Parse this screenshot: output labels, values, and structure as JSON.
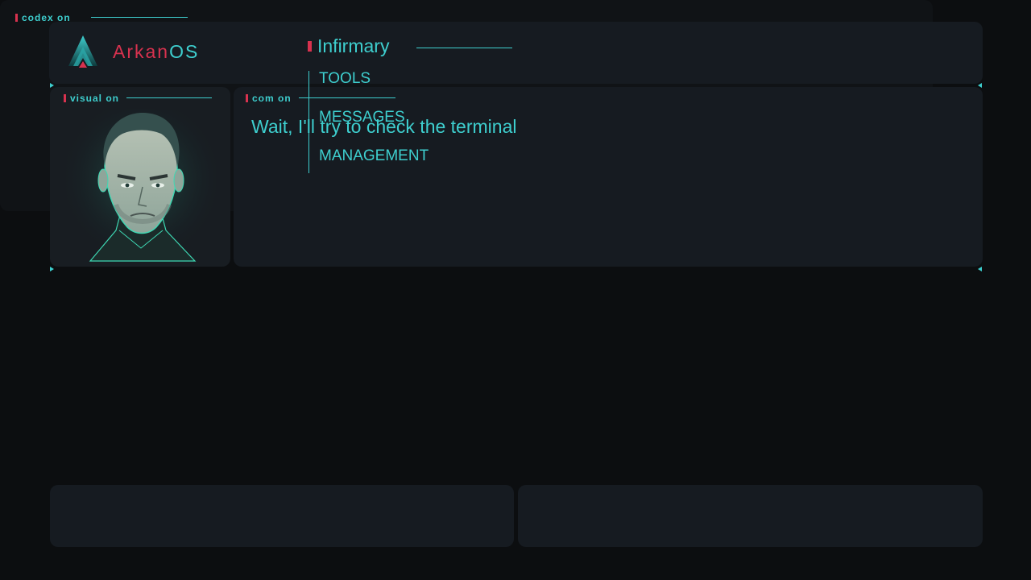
{
  "header": {
    "brand_part1": "Arkan",
    "brand_part2": "OS",
    "logo_icon": "arkanos-logo-icon"
  },
  "visual": {
    "tag": "visual on",
    "portrait_icon": "portrait-image"
  },
  "com": {
    "tag": "com on",
    "message": "Wait, I'll try to check the terminal"
  },
  "codex": {
    "tag": "codex on",
    "title": "Infirmary",
    "menu": [
      {
        "label": "TOOLS"
      },
      {
        "label": "MESSAGES"
      },
      {
        "label": "MANAGEMENT"
      }
    ]
  },
  "colors": {
    "accent": "#3ecfcf",
    "accent_red": "#d8324f",
    "panel_bg": "#161b21",
    "page_bg": "#0c0e10"
  }
}
